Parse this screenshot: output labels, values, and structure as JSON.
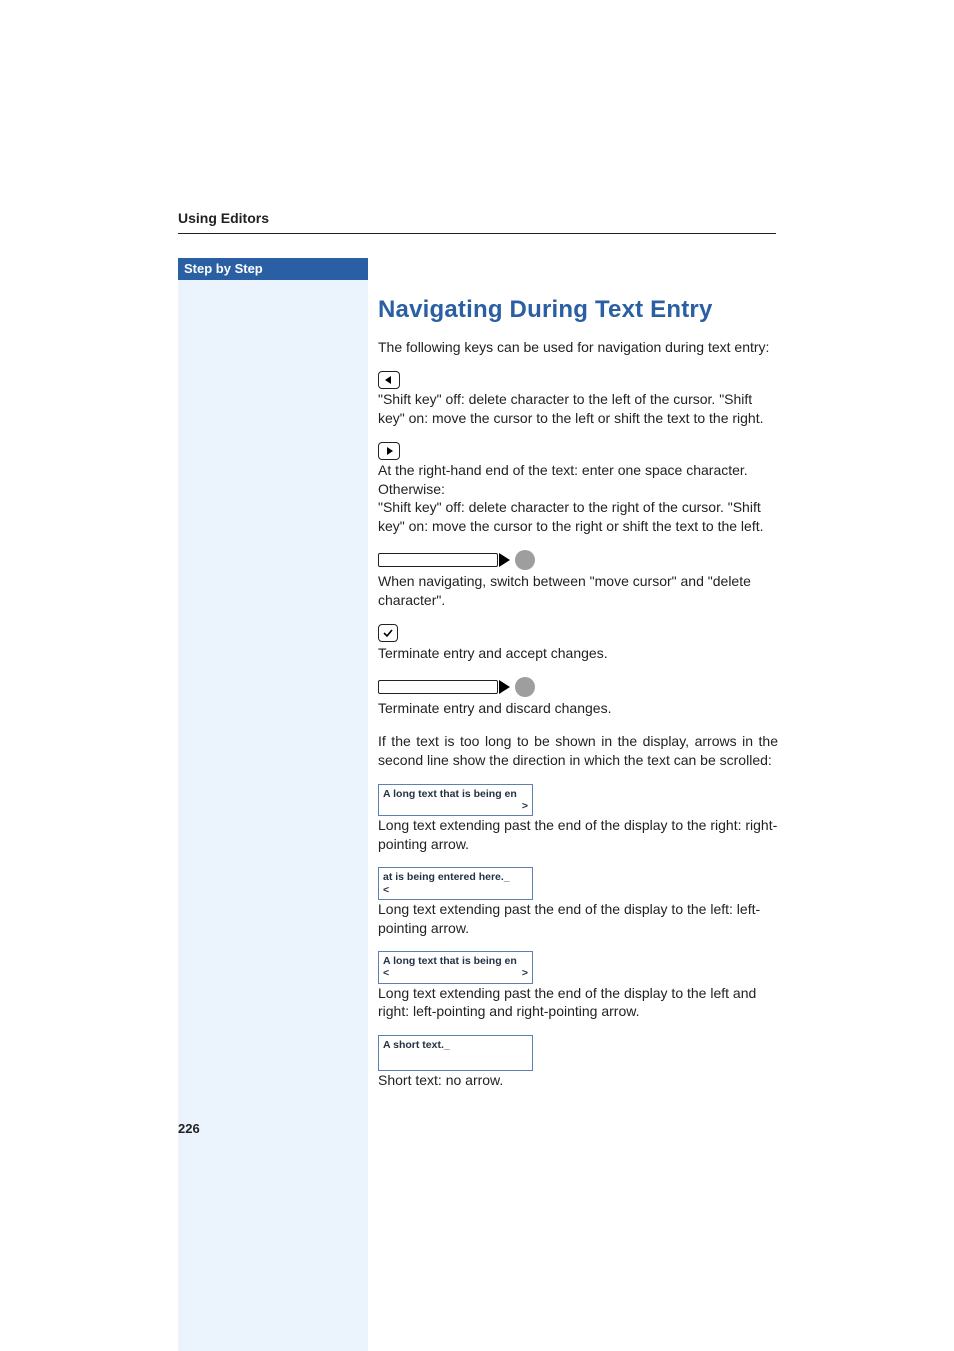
{
  "running_head": "Using Editors",
  "sidebar_tab": "Step by Step",
  "page_number": "226",
  "section_title": "Navigating During Text Entry",
  "intro": "The following keys can be used for navigation during text entry:",
  "items": {
    "left_key": "\"Shift key\" off: delete character to the left of the cursor. \"Shift key\" on: move the cursor to the left or shift the text to the right.",
    "right_key": "At the right-hand end of the text: enter one space character.\nOtherwise:\n\"Shift key\" off: delete character to the right of the cursor. \"Shift key\" on: move the cursor to the right or shift the text to the left.",
    "slider1": "When navigating, switch between \"move cursor\" and \"delete character\".",
    "check": "Terminate entry and accept changes.",
    "slider2": "Terminate entry and discard changes.",
    "scroll_intro": "If the text is too long to be shown in the display, arrows in the second line show the direction in which the text can be scrolled:",
    "disp1_text": "Long text extending past the end of the display to the right: right-pointing arrow.",
    "disp2_text": "Long text extending past the end of the display to the left: left-pointing arrow.",
    "disp3_text": "Long text extending past the end of the display to the left and right: left-pointing and right-pointing arrow.",
    "disp4_text": "Short text: no arrow."
  },
  "displays": {
    "d1_line1": "A long text that is being en",
    "d1_left": "",
    "d1_right": ">",
    "d2_line1": "at is being entered here._",
    "d2_left": "<",
    "d2_right": "",
    "d3_line1": "A long text that is being en",
    "d3_left": "<",
    "d3_right": ">",
    "d4_line1": "A short text._",
    "d4_left": "",
    "d4_right": ""
  }
}
